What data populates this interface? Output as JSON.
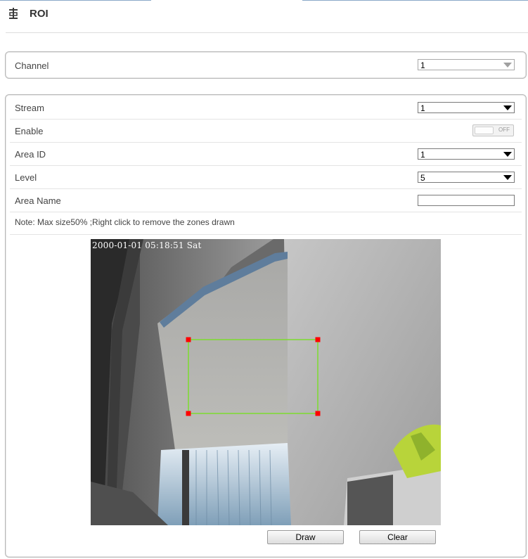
{
  "page": {
    "title": "ROI"
  },
  "channel": {
    "label": "Channel",
    "value": "1"
  },
  "form": {
    "stream": {
      "label": "Stream",
      "value": "1"
    },
    "enable": {
      "label": "Enable",
      "state": "OFF"
    },
    "area_id": {
      "label": "Area ID",
      "value": "1"
    },
    "level": {
      "label": "Level",
      "value": "5"
    },
    "area_name": {
      "label": "Area Name",
      "value": ""
    }
  },
  "note": "Note: Max size50% ;Right click to remove the zones drawn",
  "video": {
    "osd_timestamp": "2000-01-01 05:18:51 Sat",
    "roi_box_color": "#7ddc2e",
    "handle_color": "#ff0000"
  },
  "buttons": {
    "draw": "Draw",
    "clear": "Clear"
  },
  "icons": {
    "page_icon": "roi-settings-icon"
  }
}
